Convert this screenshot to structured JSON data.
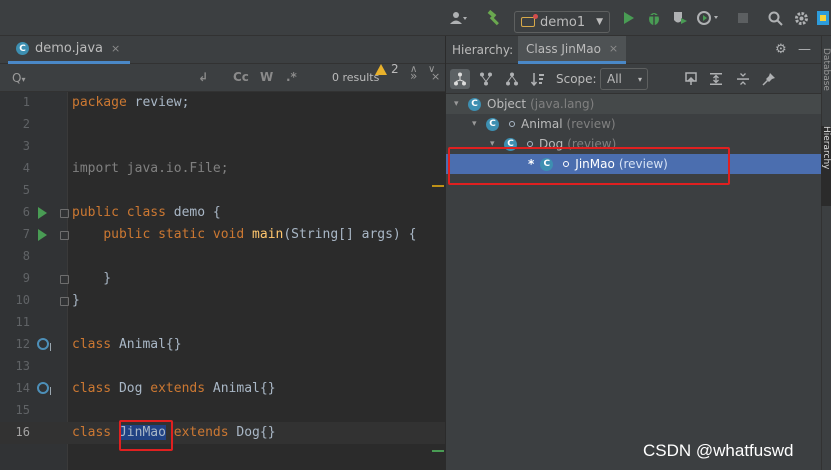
{
  "toolbar": {
    "run_config_label": "demo1",
    "colors": {
      "run": "#499c54",
      "debug": "#499c54",
      "build": "#6aa84f"
    }
  },
  "editor": {
    "tab_label": "demo.java",
    "tab_close": "×",
    "find": {
      "search_icon": "Q",
      "search_caret": "▾",
      "placeholder": "",
      "option_case": "Cc",
      "option_words": "W",
      "option_regex": ".*",
      "results": "0 results",
      "more": "»",
      "close": "×"
    },
    "warnings": {
      "count": "2",
      "prev": "∧",
      "next": "∨"
    },
    "lines": [
      {
        "n": "1"
      },
      {
        "n": "2"
      },
      {
        "n": "3"
      },
      {
        "n": "4"
      },
      {
        "n": "5"
      },
      {
        "n": "6"
      },
      {
        "n": "7"
      },
      {
        "n": "8"
      },
      {
        "n": "9"
      },
      {
        "n": "10"
      },
      {
        "n": "11"
      },
      {
        "n": "12"
      },
      {
        "n": "13"
      },
      {
        "n": "14"
      },
      {
        "n": "15"
      },
      {
        "n": "16"
      }
    ],
    "tokens": {
      "package_kw": "package",
      "package_name": " review;",
      "import_stmt": "import java.io.File;",
      "public_kw": "public",
      "class_kw": "class",
      "demo_name": " demo {",
      "indent": "    ",
      "static_kw": "static",
      "void_kw": "void",
      "main_fn": "main",
      "main_args": "(String[] args) {",
      "close_brace_indented": "    }",
      "close_brace": "}",
      "animal_decl": " Animal{}",
      "dog_name": " Dog ",
      "extends_kw": "extends",
      "animal_braces": " Animal{}",
      "jinmao_name": "JinMao",
      "dog_braces": " Dog{}",
      "space": " "
    }
  },
  "hierarchy": {
    "label": "Hierarchy:",
    "tab_label": "Class JinMao",
    "tab_close": "×",
    "header_icons": {
      "settings": "⚙",
      "minimize": "—"
    },
    "toolbar": {
      "scope_label": "Scope:",
      "scope_value": "All",
      "scope_caret": "▾"
    },
    "tree": [
      {
        "arrow": "▾",
        "name": "Object",
        "pkg": "(java.lang)"
      },
      {
        "arrow": "▾",
        "name": "Animal",
        "pkg": "(review)"
      },
      {
        "arrow": "▾",
        "name": "Dog",
        "pkg": "(review)"
      },
      {
        "star": "*",
        "name": "JinMao",
        "pkg": "(review)"
      }
    ],
    "selection_color": "#4b6eaf"
  },
  "right_stripe": {
    "database": "Database",
    "hierarchy": "Hierarchy"
  },
  "watermark": "CSDN @whatfuswd"
}
